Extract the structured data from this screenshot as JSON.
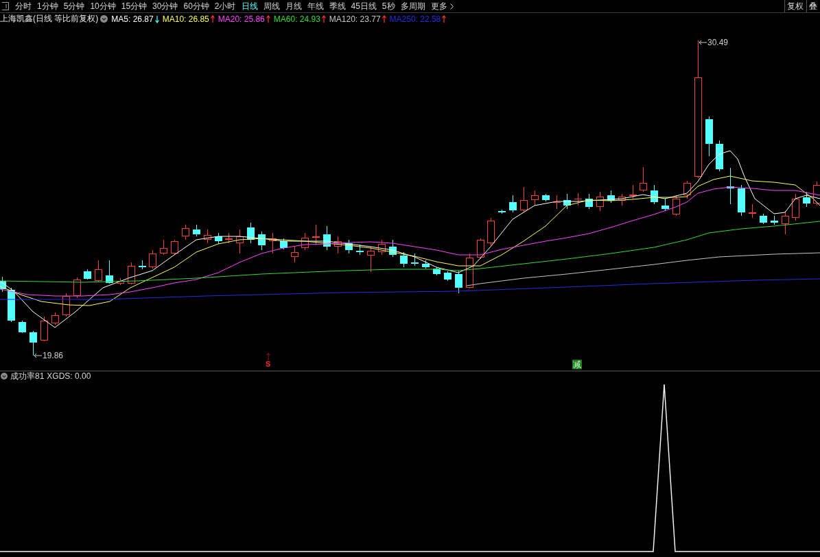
{
  "toolbar": {
    "tabs": [
      {
        "label": "分时",
        "selected": false
      },
      {
        "label": "1分钟",
        "selected": false
      },
      {
        "label": "5分钟",
        "selected": false
      },
      {
        "label": "10分钟",
        "selected": false
      },
      {
        "label": "15分钟",
        "selected": false
      },
      {
        "label": "30分钟",
        "selected": false
      },
      {
        "label": "60分钟",
        "selected": false
      },
      {
        "label": "2小时",
        "selected": false
      },
      {
        "label": "日线",
        "selected": true
      },
      {
        "label": "周线",
        "selected": false
      },
      {
        "label": "月线",
        "selected": false
      },
      {
        "label": "年线",
        "selected": false
      },
      {
        "label": "季线",
        "selected": false
      },
      {
        "label": "45日线",
        "selected": false
      },
      {
        "label": "5秒",
        "selected": false
      },
      {
        "label": "多周期",
        "selected": false
      }
    ],
    "more_menu": {
      "label": "更多"
    },
    "right_buttons": [
      {
        "label": "复权"
      },
      {
        "label": "叠"
      }
    ]
  },
  "stock_info": {
    "title": "上海凯鑫(日线 等比前复权)",
    "moving_averages": [
      {
        "label": "MA5: 26.87",
        "rising": false,
        "color": "#ffffff"
      },
      {
        "label": "MA10: 26.85",
        "rising": true,
        "color": "#ffff55"
      },
      {
        "label": "MA20: 25.86",
        "rising": true,
        "color": "#ff44ff"
      },
      {
        "label": "MA60: 24.93",
        "rising": true,
        "color": "#33dd33"
      },
      {
        "label": "MA120: 23.77",
        "rising": true,
        "color": "#c8c8c8"
      },
      {
        "label": "MA250: 22.58",
        "rising": true,
        "color": "#2a2ae0"
      }
    ]
  },
  "main_chart": {
    "high_label": "30.49",
    "low_label": "19.86",
    "signals": [
      {
        "kind": "arrow",
        "label": "S"
      },
      {
        "kind": "boxed",
        "label": "减"
      }
    ]
  },
  "indicator_panel": {
    "title": "成功率81",
    "reading": "XGDS: 0.00"
  }
}
